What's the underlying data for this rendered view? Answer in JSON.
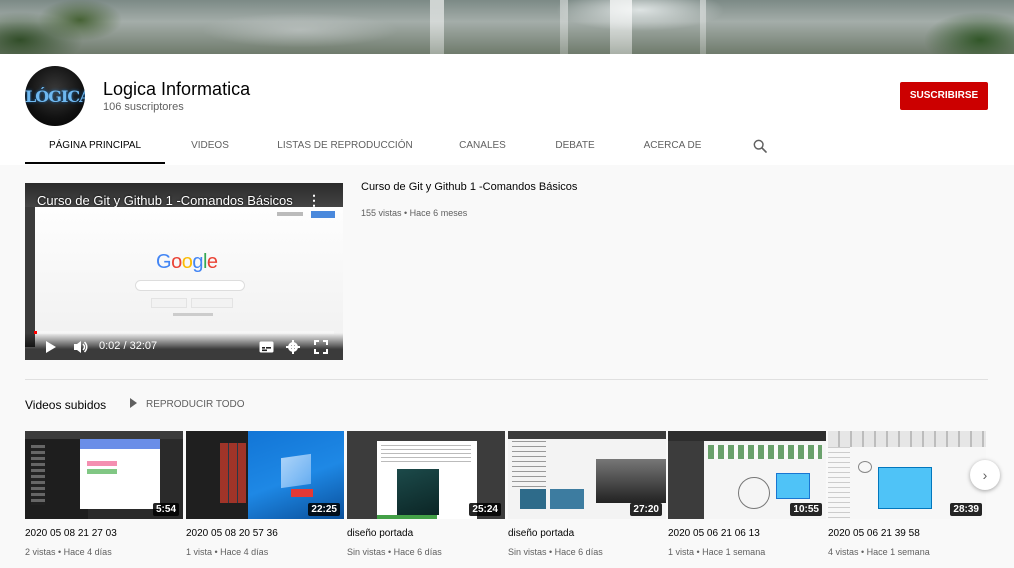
{
  "channel": {
    "name": "Logica Informatica",
    "subscribers": "106 suscriptores",
    "avatar_text": "LÓGICA",
    "subscribe_label": "SUSCRIBIRSE"
  },
  "tabs": [
    {
      "label": "PÁGINA PRINCIPAL",
      "active": true
    },
    {
      "label": "VIDEOS"
    },
    {
      "label": "LISTAS DE REPRODUCCIÓN"
    },
    {
      "label": "CANALES"
    },
    {
      "label": "DEBATE"
    },
    {
      "label": "ACERCA DE"
    }
  ],
  "featured": {
    "overlay_title": "Curso de Git y Github 1 -Comandos Básicos",
    "title": "Curso de Git y Github 1 -Comandos Básicos",
    "meta": "155 vistas • Hace 6 meses",
    "time": "0:02 / 32:07",
    "progress": 0.001,
    "google": "Google"
  },
  "uploads": {
    "title": "Videos subidos",
    "play_all": "REPRODUCIR TODO",
    "videos": [
      {
        "title": "2020 05 08 21 27 03",
        "meta": "2 vistas • Hace 4 días",
        "duration": "5:54"
      },
      {
        "title": "2020 05 08 20 57 36",
        "meta": "1 vista • Hace 4 días",
        "duration": "22:25"
      },
      {
        "title": "diseño portada",
        "meta": "Sin vistas • Hace 6 días",
        "duration": "25:24"
      },
      {
        "title": "diseño portada",
        "meta": "Sin vistas • Hace 6 días",
        "duration": "27:20"
      },
      {
        "title": "2020 05 06 21 06 13",
        "meta": "1 vista • Hace 1 semana",
        "duration": "10:55"
      },
      {
        "title": "2020 05 06 21 39 58",
        "meta": "4 vistas • Hace 1 semana",
        "duration": "28:39"
      }
    ]
  },
  "colors": {
    "subscribe": "#cc0000",
    "progress": "#ff0000"
  },
  "icons": [
    "search-icon",
    "play-icon",
    "volume-icon",
    "subtitles-icon",
    "settings-icon",
    "fullscreen-icon",
    "more-vert-icon",
    "chevron-right-icon"
  ]
}
